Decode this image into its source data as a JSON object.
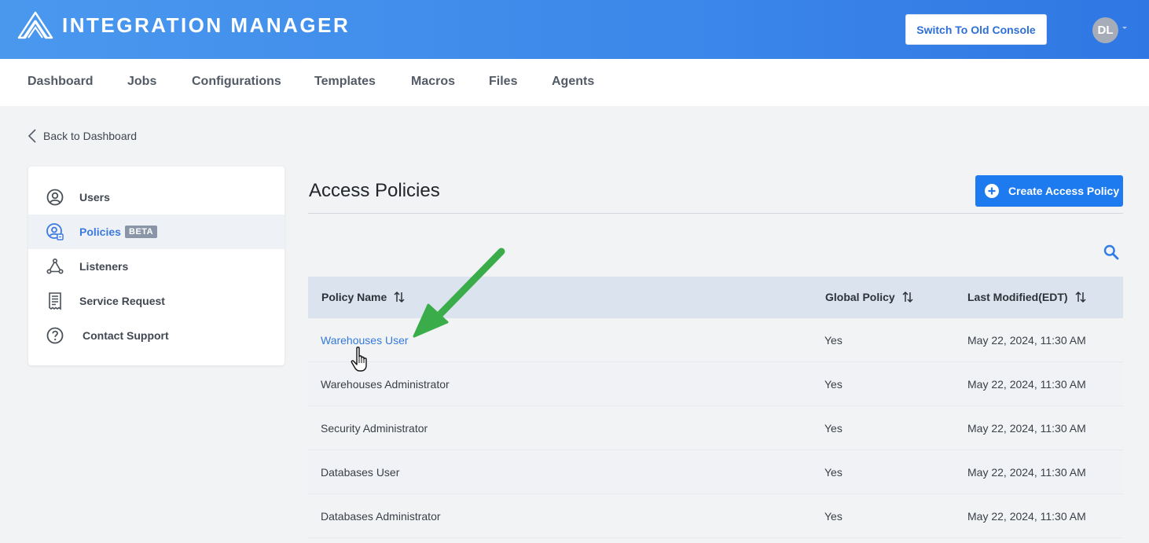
{
  "header": {
    "app_title": "INTEGRATION MANAGER",
    "switch_label": "Switch To Old Console",
    "avatar_initials": "DL",
    "brand_color": "#3b87ea"
  },
  "nav": {
    "items": [
      "Dashboard",
      "Jobs",
      "Configurations",
      "Templates",
      "Macros",
      "Files",
      "Agents"
    ]
  },
  "back": {
    "label": "Back to Dashboard"
  },
  "sidebar": {
    "items": [
      {
        "label": "Users",
        "icon": "user-circle-icon"
      },
      {
        "label": "Policies",
        "icon": "policy-user-icon",
        "badge": "BETA",
        "active": true
      },
      {
        "label": "Listeners",
        "icon": "listener-icon"
      },
      {
        "label": "Service Request",
        "icon": "receipt-icon"
      },
      {
        "label": "Contact Support",
        "icon": "help-circle-icon"
      }
    ]
  },
  "main": {
    "title": "Access Policies",
    "create_label": "Create Access Policy"
  },
  "table": {
    "columns": [
      "Policy Name",
      "Global Policy",
      "Last Modified(EDT)"
    ],
    "rows": [
      {
        "name": "Warehouses User",
        "global": "Yes",
        "modified": "May 22, 2024, 11:30 AM"
      },
      {
        "name": "Warehouses Administrator",
        "global": "Yes",
        "modified": "May 22, 2024, 11:30 AM"
      },
      {
        "name": "Security Administrator",
        "global": "Yes",
        "modified": "May 22, 2024, 11:30 AM"
      },
      {
        "name": "Databases User",
        "global": "Yes",
        "modified": "May 22, 2024, 11:30 AM"
      },
      {
        "name": "Databases Administrator",
        "global": "Yes",
        "modified": "May 22, 2024, 11:30 AM"
      }
    ]
  },
  "annotation": {
    "arrow_color": "#3aad4a"
  }
}
